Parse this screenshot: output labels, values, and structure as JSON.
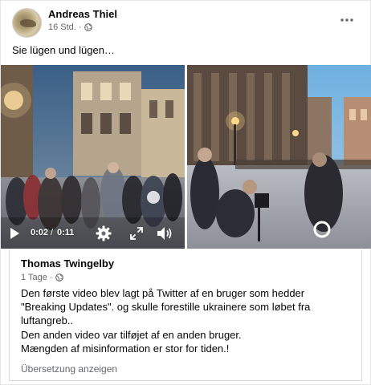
{
  "post": {
    "author": "Andreas Thiel",
    "time": "16 Std.",
    "meta_separator": "·",
    "text": "Sie lügen und lügen…",
    "more_icon": "more-horizontal-icon",
    "privacy_icon": "globe-icon"
  },
  "video": {
    "time_current": "0:02",
    "time_separator": "/",
    "time_total": "0:11",
    "progress": 0.18,
    "icons": [
      "play-icon",
      "gear-icon",
      "fullscreen-icon",
      "volume-icon"
    ]
  },
  "shared": {
    "author": "Thomas Twingelby",
    "time": "1 Tage",
    "meta_separator": "·",
    "body_lines": [
      "Den første video blev lagt på Twitter af en bruger som hedder",
      "\"Breaking Updates\". og skulle forestille ukrainere som løbet fra",
      "luftangreb..",
      "Den anden video var tilføjet af en anden bruger.",
      "Mængden af misinformation er stor for tiden.!"
    ],
    "translate_label": "Übersetzung anzeigen"
  },
  "colors": {
    "text_primary": "#050505",
    "text_secondary": "#65676b",
    "border": "#d9dadf"
  }
}
